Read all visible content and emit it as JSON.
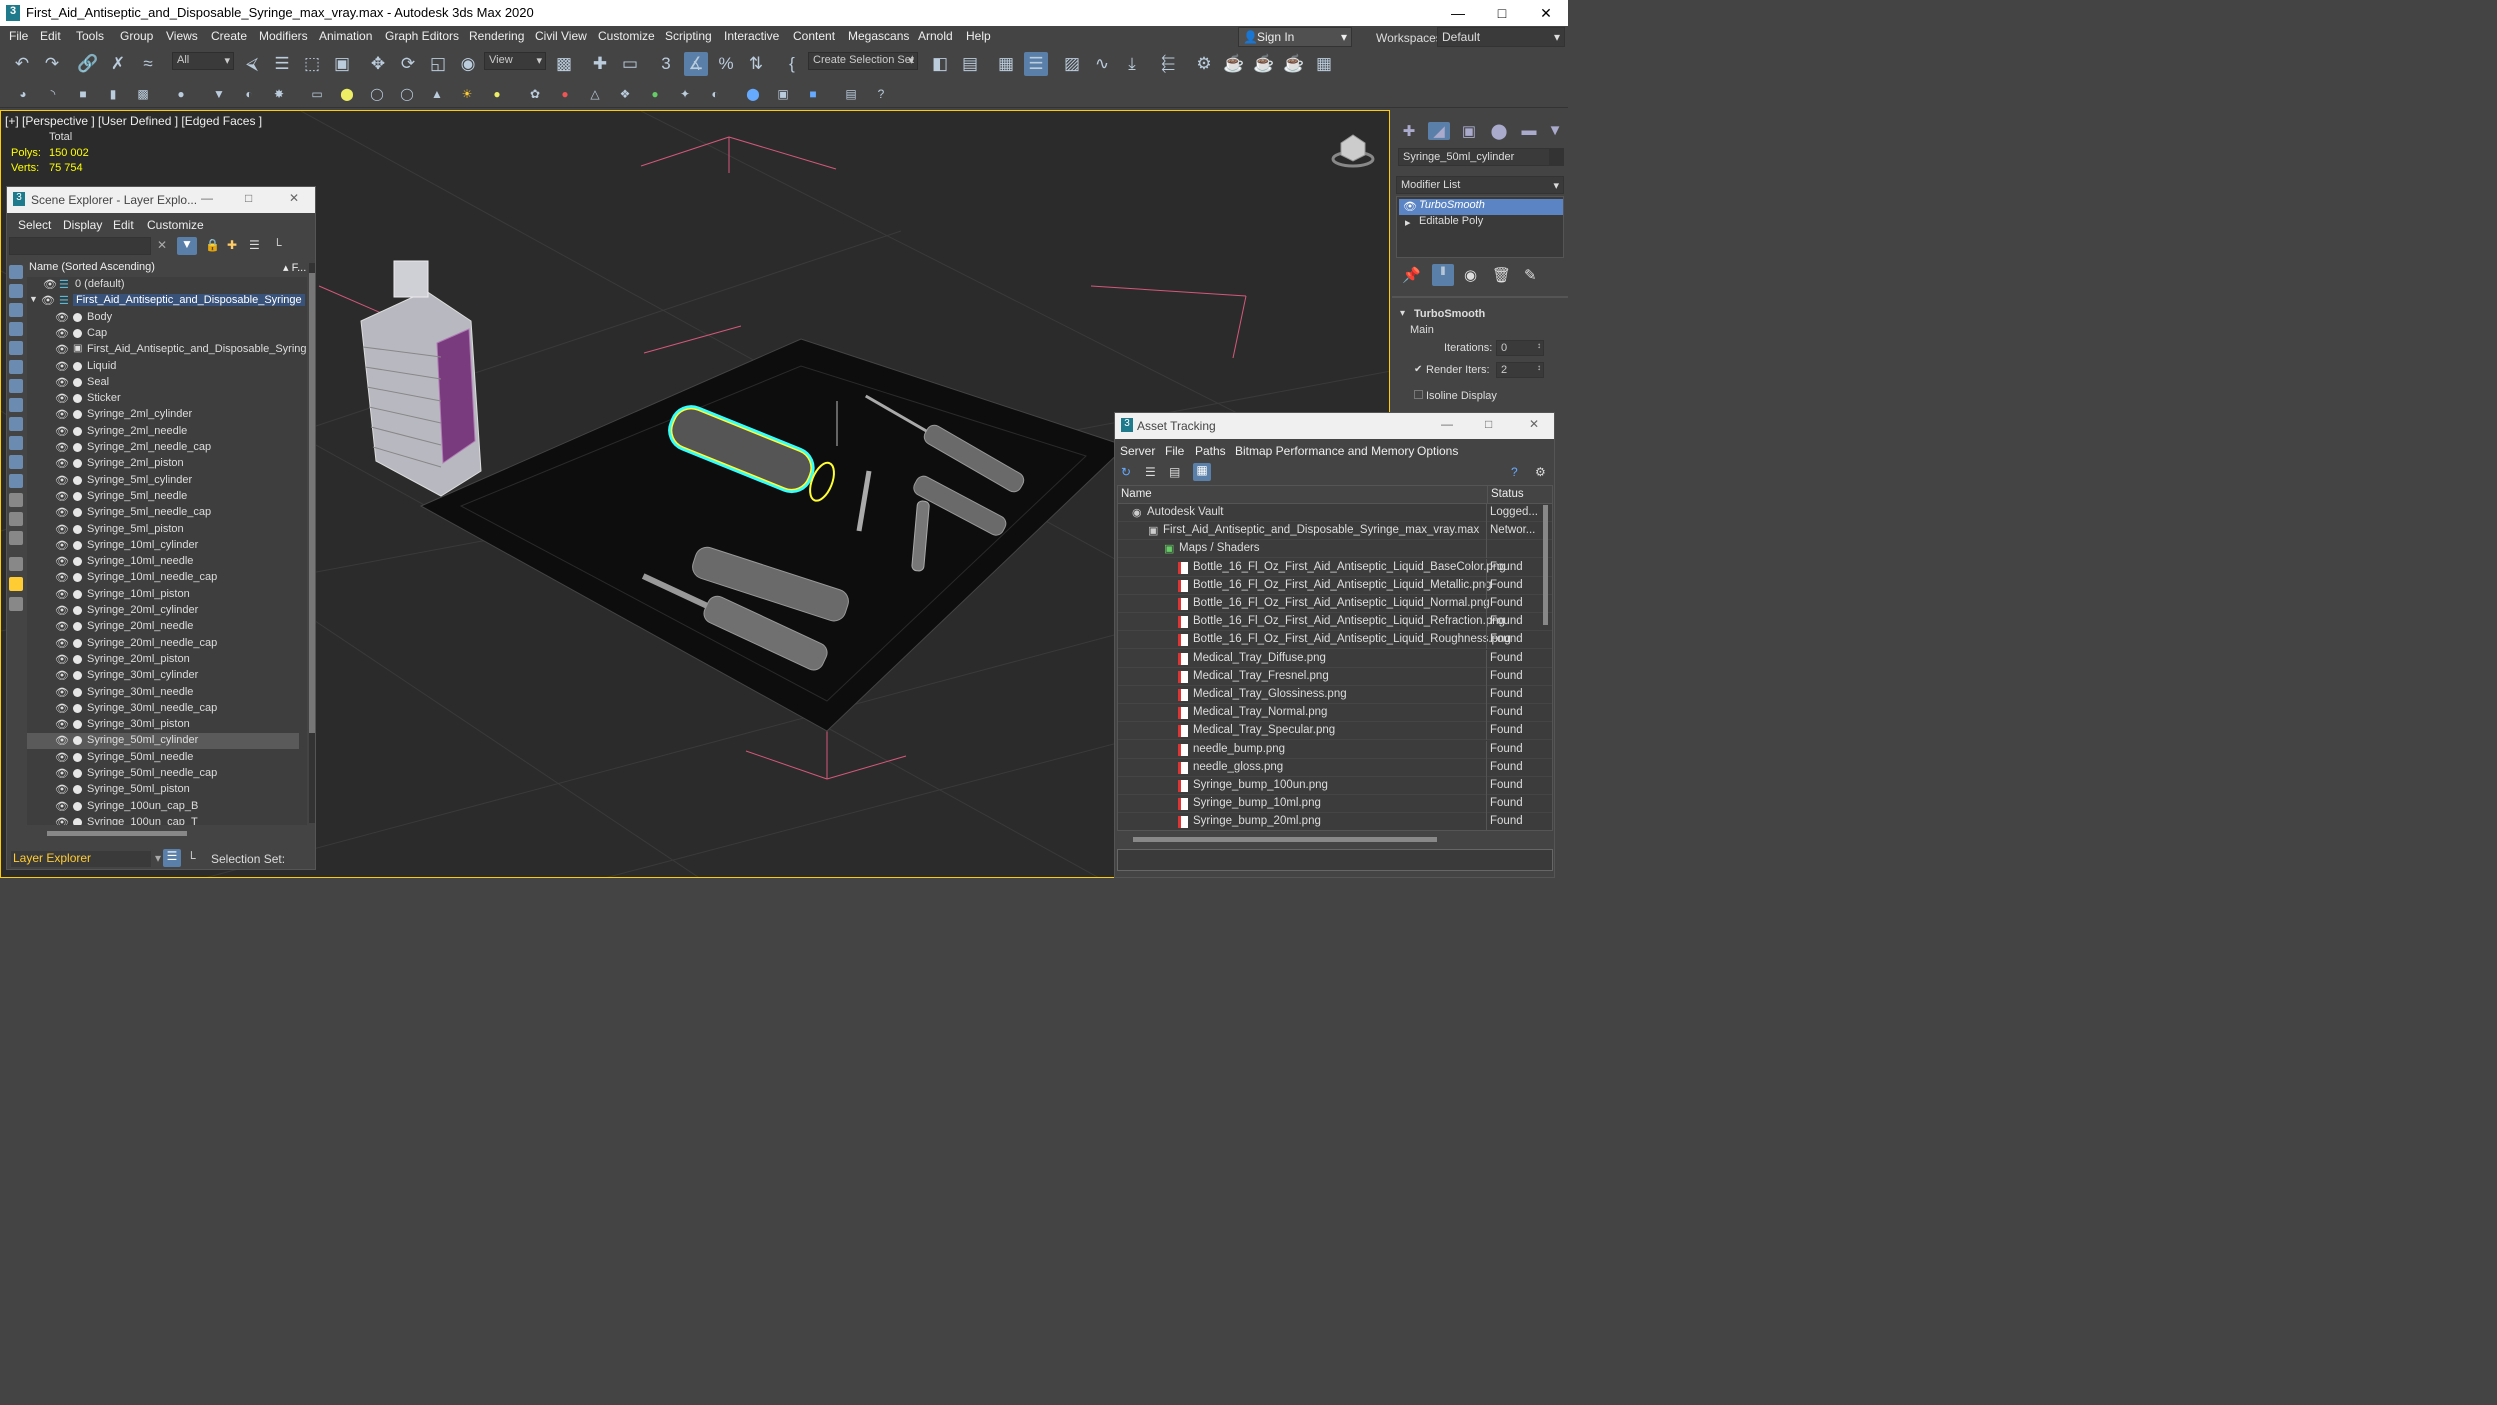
{
  "window": {
    "title": "First_Aid_Antiseptic_and_Disposable_Syringe_max_vray.max - Autodesk 3ds Max 2020",
    "app_logo": "3"
  },
  "menu": [
    "File",
    "Edit",
    "Tools",
    "Group",
    "Views",
    "Create",
    "Modifiers",
    "Animation",
    "Graph Editors",
    "Rendering",
    "Civil View",
    "Customize",
    "Scripting",
    "Interactive",
    "Content",
    "Megascans",
    "Arnold",
    "Help"
  ],
  "account": {
    "sign_in": "Sign In",
    "workspaces_label": "Workspaces:",
    "workspace": "Default"
  },
  "toolbar": {
    "selection_filter": "All",
    "ref_coord": "View",
    "create_selection_set": "Create Selection Set"
  },
  "viewport": {
    "label": "[+] [Perspective ] [User Defined ] [Edged Faces ]",
    "stats_header": "Total",
    "polys_label": "Polys:",
    "polys_value": "150 002",
    "verts_label": "Verts:",
    "verts_value": "75 754"
  },
  "scene_explorer": {
    "title": "Scene Explorer - Layer Explo...",
    "menu": [
      "Select",
      "Display",
      "Edit",
      "Customize"
    ],
    "column_name": "Name (Sorted Ascending)",
    "column_f": "▴ F...",
    "layer_default": "0 (default)",
    "parent": "First_Aid_Antiseptic_and_Disposable_Syringe",
    "items": [
      "Body",
      "Cap",
      "First_Aid_Antiseptic_and_Disposable_Syringe",
      "Liquid",
      "Seal",
      "Sticker",
      "Syringe_2ml_cylinder",
      "Syringe_2ml_needle",
      "Syringe_2ml_needle_cap",
      "Syringe_2ml_piston",
      "Syringe_5ml_cylinder",
      "Syringe_5ml_needle",
      "Syringe_5ml_needle_cap",
      "Syringe_5ml_piston",
      "Syringe_10ml_cylinder",
      "Syringe_10ml_needle",
      "Syringe_10ml_needle_cap",
      "Syringe_10ml_piston",
      "Syringe_20ml_cylinder",
      "Syringe_20ml_needle",
      "Syringe_20ml_needle_cap",
      "Syringe_20ml_piston",
      "Syringe_30ml_cylinder",
      "Syringe_30ml_needle",
      "Syringe_30ml_needle_cap",
      "Syringe_30ml_piston",
      "Syringe_50ml_cylinder",
      "Syringe_50ml_needle",
      "Syringe_50ml_needle_cap",
      "Syringe_50ml_piston",
      "Syringe_100un_cap_B",
      "Syringe_100un_cap_T"
    ],
    "selected_item": "Syringe_50ml_cylinder",
    "bottom_layer": "Layer Explorer",
    "bottom_selset": "Selection Set:"
  },
  "command_panel": {
    "object_name": "Syringe_50ml_cylinder",
    "modifier_list": "Modifier List",
    "stack": [
      "TurboSmooth",
      "Editable Poly"
    ],
    "rollout_title": "TurboSmooth",
    "main_label": "Main",
    "iterations_label": "Iterations:",
    "iterations_value": "0",
    "render_iters_label": "Render Iters:",
    "render_iters_value": "2",
    "render_iters_checked": true,
    "isoline_label": "Isoline Display",
    "isoline_checked": false
  },
  "asset_tracking": {
    "title": "Asset Tracking",
    "menu": [
      "Server",
      "File",
      "Paths",
      "Bitmap Performance and Memory",
      "Options"
    ],
    "col_name": "Name",
    "col_status": "Status",
    "rows": [
      {
        "name": "Autodesk Vault",
        "status": "Logged...",
        "indent": 1,
        "kind": "vault"
      },
      {
        "name": "First_Aid_Antiseptic_and_Disposable_Syringe_max_vray.max",
        "status": "Networ...",
        "indent": 2,
        "kind": "max"
      },
      {
        "name": "Maps / Shaders",
        "status": "",
        "indent": 3,
        "kind": "folder"
      },
      {
        "name": "Bottle_16_Fl_Oz_First_Aid_Antiseptic_Liquid_BaseColor.png",
        "status": "Found",
        "indent": 4,
        "kind": "file"
      },
      {
        "name": "Bottle_16_Fl_Oz_First_Aid_Antiseptic_Liquid_Metallic.png",
        "status": "Found",
        "indent": 4,
        "kind": "file"
      },
      {
        "name": "Bottle_16_Fl_Oz_First_Aid_Antiseptic_Liquid_Normal.png",
        "status": "Found",
        "indent": 4,
        "kind": "file"
      },
      {
        "name": "Bottle_16_Fl_Oz_First_Aid_Antiseptic_Liquid_Refraction.png",
        "status": "Found",
        "indent": 4,
        "kind": "file"
      },
      {
        "name": "Bottle_16_Fl_Oz_First_Aid_Antiseptic_Liquid_Roughness.png",
        "status": "Found",
        "indent": 4,
        "kind": "file"
      },
      {
        "name": "Medical_Tray_Diffuse.png",
        "status": "Found",
        "indent": 4,
        "kind": "file"
      },
      {
        "name": "Medical_Tray_Fresnel.png",
        "status": "Found",
        "indent": 4,
        "kind": "file"
      },
      {
        "name": "Medical_Tray_Glossiness.png",
        "status": "Found",
        "indent": 4,
        "kind": "file"
      },
      {
        "name": "Medical_Tray_Normal.png",
        "status": "Found",
        "indent": 4,
        "kind": "file"
      },
      {
        "name": "Medical_Tray_Specular.png",
        "status": "Found",
        "indent": 4,
        "kind": "file"
      },
      {
        "name": "needle_bump.png",
        "status": "Found",
        "indent": 4,
        "kind": "file"
      },
      {
        "name": "needle_gloss.png",
        "status": "Found",
        "indent": 4,
        "kind": "file"
      },
      {
        "name": "Syringe_bump_100un.png",
        "status": "Found",
        "indent": 4,
        "kind": "file"
      },
      {
        "name": "Syringe_bump_10ml.png",
        "status": "Found",
        "indent": 4,
        "kind": "file"
      },
      {
        "name": "Syringe_bump_20ml.png",
        "status": "Found",
        "indent": 4,
        "kind": "file"
      }
    ]
  },
  "colors": {
    "ui_bg": "#444444",
    "viewport_bg": "#2b2b2b",
    "stat_yellow": "#ffff00",
    "selection_blue": "#5a84c4",
    "viewport_border": "#ffcc00"
  }
}
